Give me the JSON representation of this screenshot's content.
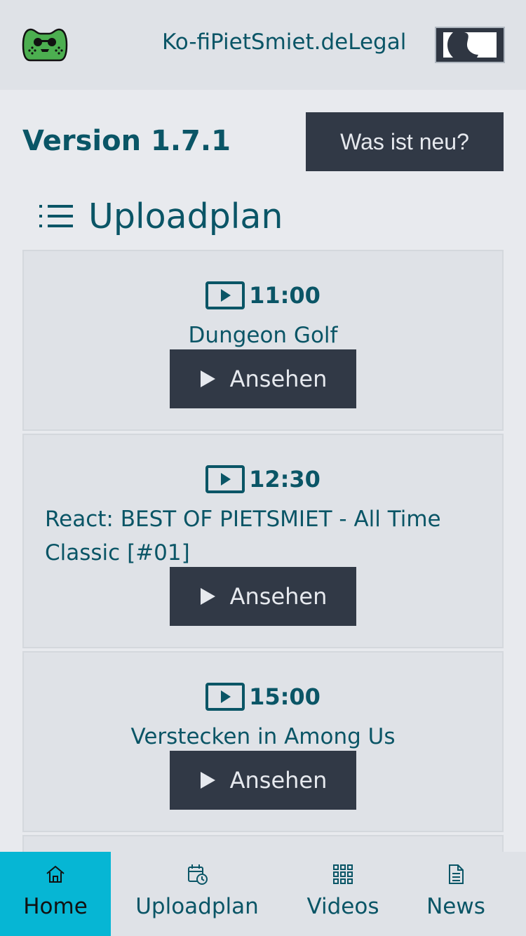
{
  "header": {
    "links": [
      "Ko-fi",
      "PietSmiet.de",
      "Legal"
    ]
  },
  "version": {
    "label": "Version 1.7.1",
    "whats_new_button": "Was ist neu?"
  },
  "section": {
    "title": "Uploadplan"
  },
  "uploads": [
    {
      "time": "11:00",
      "title": "Dungeon Golf",
      "button": "Ansehen"
    },
    {
      "time": "12:30",
      "title": "React: BEST OF PIETSMIET - All Time Classic [#01]",
      "button": "Ansehen"
    },
    {
      "time": "15:00",
      "title": "Verstecken in Among Us",
      "button": "Ansehen"
    }
  ],
  "bottom_nav": [
    {
      "label": "Home",
      "icon": "home-icon",
      "active": true
    },
    {
      "label": "Uploadplan",
      "icon": "calendar-clock-icon",
      "active": false
    },
    {
      "label": "Videos",
      "icon": "grid-icon",
      "active": false
    },
    {
      "label": "News",
      "icon": "document-icon",
      "active": false
    }
  ],
  "colors": {
    "accent": "#06b6d4",
    "text": "#0a5566",
    "button_bg": "#313946"
  }
}
